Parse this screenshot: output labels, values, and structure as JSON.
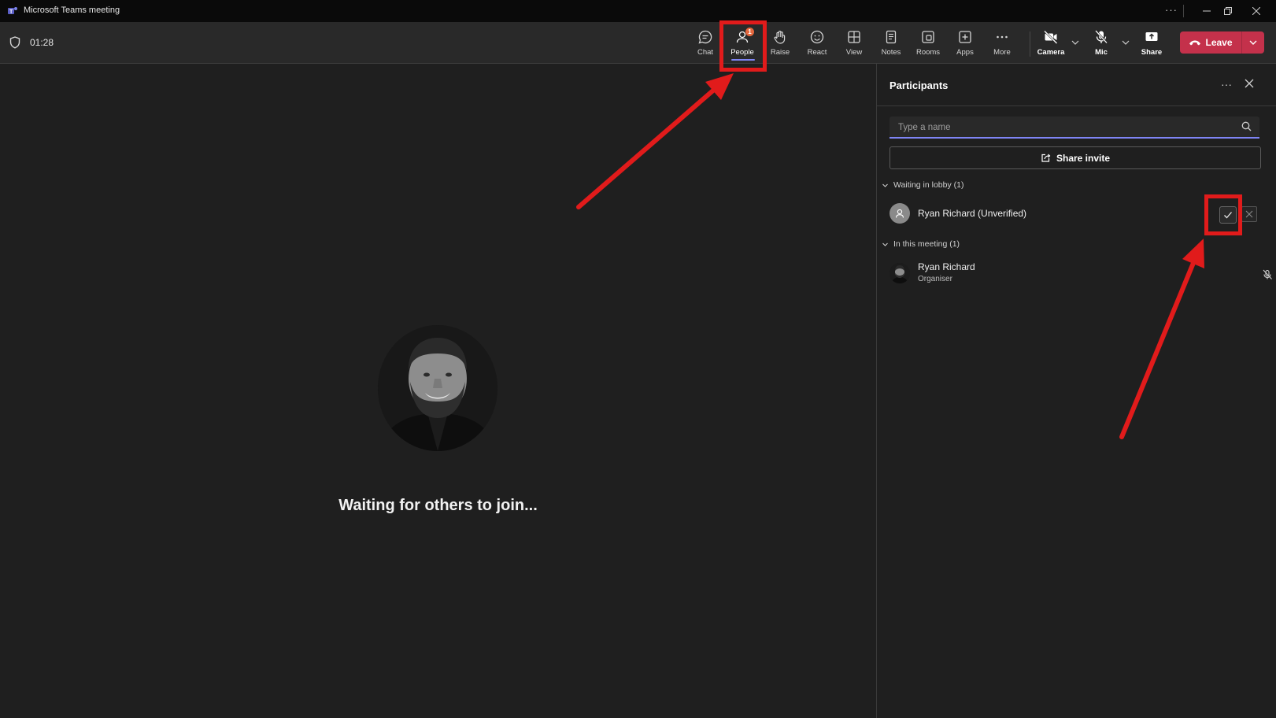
{
  "window": {
    "title": "Microsoft Teams meeting",
    "more_label": "···"
  },
  "meeting": {
    "timer": "01:28"
  },
  "toolbar": {
    "buttons": [
      {
        "id": "chat",
        "label": "Chat",
        "icon": "chat-icon"
      },
      {
        "id": "people",
        "label": "People",
        "icon": "people-icon",
        "badge": "1",
        "active": true
      },
      {
        "id": "raise",
        "label": "Raise",
        "icon": "raise-hand-icon"
      },
      {
        "id": "react",
        "label": "React",
        "icon": "react-emoji-icon"
      },
      {
        "id": "view",
        "label": "View",
        "icon": "view-grid-icon"
      },
      {
        "id": "notes",
        "label": "Notes",
        "icon": "notes-icon"
      },
      {
        "id": "rooms",
        "label": "Rooms",
        "icon": "rooms-icon"
      },
      {
        "id": "apps",
        "label": "Apps",
        "icon": "apps-icon"
      },
      {
        "id": "more",
        "label": "More",
        "icon": "more-icon"
      },
      {
        "id": "camera",
        "label": "Camera",
        "icon": "camera-off-icon"
      },
      {
        "id": "mic",
        "label": "Mic",
        "icon": "mic-off-icon"
      },
      {
        "id": "share",
        "label": "Share",
        "icon": "share-tray-icon"
      }
    ],
    "leave_label": "Leave",
    "accent_color": "#7f85f5",
    "leave_color": "#c4314b",
    "badge_color": "#e5683e"
  },
  "stage": {
    "waiting_text": "Waiting for others to join..."
  },
  "participants": {
    "title": "Participants",
    "search_placeholder": "Type a name",
    "share_invite_label": "Share invite",
    "lobby_header": "Waiting in lobby (1)",
    "lobby": [
      {
        "name": "Ryan Richard (Unverified)"
      }
    ],
    "meeting_header": "In this meeting (1)",
    "in_meeting": [
      {
        "name": "Ryan Richard",
        "role": "Organiser",
        "muted": true
      }
    ]
  },
  "annotations": {
    "highlight_color": "#e11b1b"
  }
}
